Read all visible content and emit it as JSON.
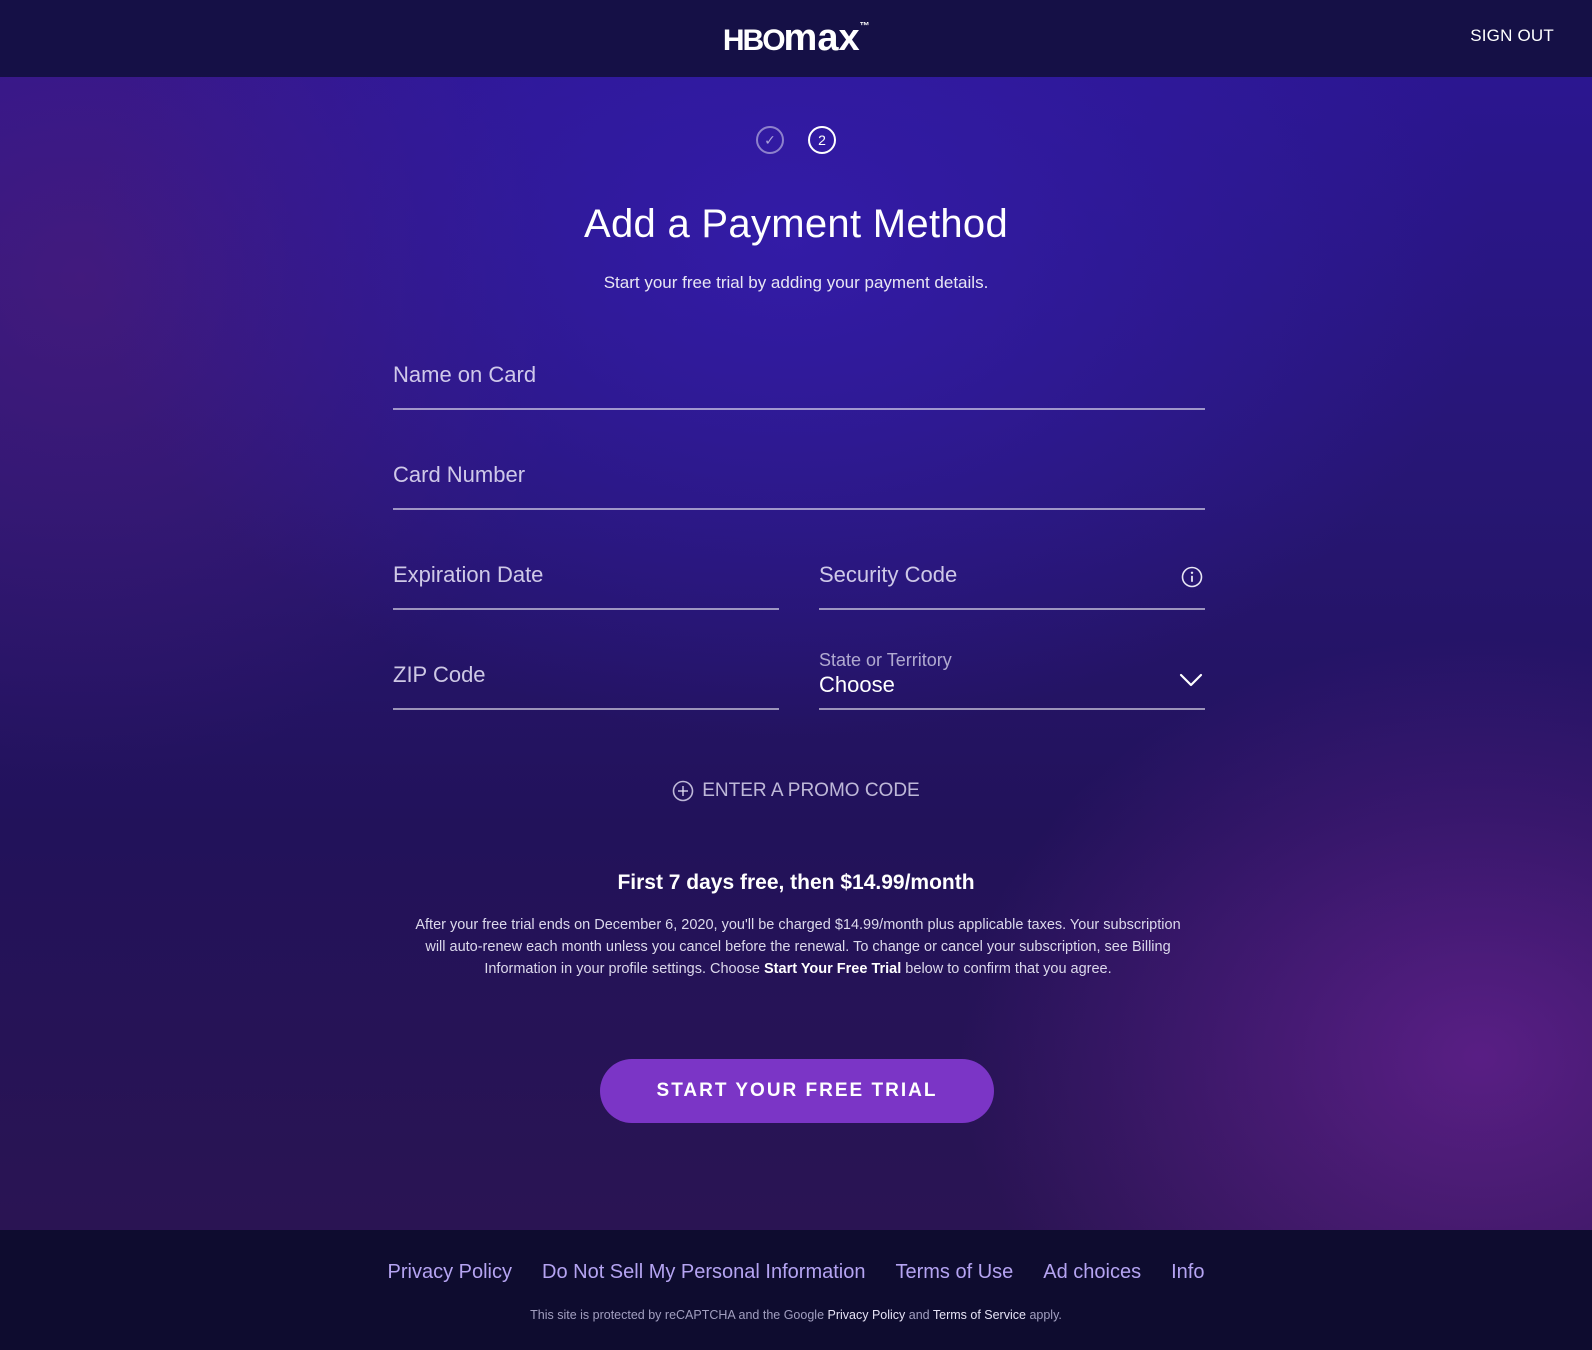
{
  "header": {
    "logo_hbo": "HBO",
    "logo_max": "max",
    "logo_tm": "™",
    "sign_out": "SIGN OUT"
  },
  "steps": [
    {
      "state": "done",
      "label": "✓"
    },
    {
      "state": "active",
      "label": "2"
    }
  ],
  "main": {
    "title": "Add a Payment Method",
    "subtitle": "Start your free trial by adding your payment details."
  },
  "form": {
    "name_on_card": {
      "placeholder": "Name on Card",
      "value": ""
    },
    "card_number": {
      "placeholder": "Card Number",
      "value": ""
    },
    "expiration_date": {
      "placeholder": "Expiration Date",
      "value": ""
    },
    "security_code": {
      "placeholder": "Security Code",
      "value": ""
    },
    "zip_code": {
      "placeholder": "ZIP Code",
      "value": ""
    },
    "state": {
      "label": "State or Territory",
      "selected": "Choose"
    }
  },
  "promo": {
    "label": "ENTER A PROMO CODE"
  },
  "offer": {
    "title": "First 7 days free, then $14.99/month",
    "text_part1": "After your free trial ends on December 6, 2020, you'll be charged $14.99/month plus applicable taxes. Your subscription will auto-renew each month unless you cancel before the renewal. To change or cancel your subscription, see Billing Information in your profile settings. Choose ",
    "text_bold": "Start Your Free Trial",
    "text_part2": " below to confirm that you agree."
  },
  "cta": {
    "label": "START YOUR FREE TRIAL"
  },
  "footer": {
    "links": [
      "Privacy Policy",
      "Do Not Sell My Personal Information",
      "Terms of Use",
      "Ad choices",
      "Info"
    ],
    "recaptcha_prefix": "This site is protected by reCAPTCHA and the Google ",
    "recaptcha_privacy": "Privacy Policy",
    "recaptcha_and": " and ",
    "recaptcha_terms": "Terms of Service",
    "recaptcha_suffix": " apply."
  },
  "colors": {
    "header_bg": "#151046",
    "cta_bg": "#7b35c6",
    "footer_link": "#b5a4f2",
    "footer_bg": "#0e0c2f"
  }
}
